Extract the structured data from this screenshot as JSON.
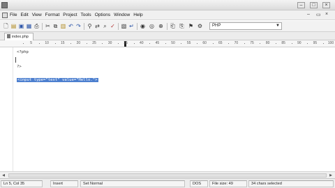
{
  "menubar": {
    "items": [
      "File",
      "Edit",
      "View",
      "Format",
      "Project",
      "Tools",
      "Options",
      "Window",
      "Help"
    ]
  },
  "toolbar": {
    "syntax_selected": "PHP"
  },
  "tabs": [
    {
      "label": "index.php"
    }
  ],
  "ruler": {
    "marks": [
      "5",
      "10",
      "15",
      "20",
      "25",
      "30",
      "35",
      "40",
      "45",
      "50",
      "55",
      "60",
      "65",
      "70",
      "75",
      "80",
      "85",
      "90",
      "95",
      "100"
    ]
  },
  "editor": {
    "lines": [
      "<?php",
      "?>",
      "<input type=\"text\" value=\"Hello.\">"
    ]
  },
  "status": {
    "position": "Ln 5, Col 35",
    "mode": "Insert",
    "style_set": "Set Normal",
    "line_endings": "DOS",
    "file_size": "File size: 49",
    "selection": "34 chars selected"
  },
  "icons": {
    "window_controls": [
      "minimize-icon",
      "maximize-icon",
      "close-icon"
    ],
    "toolbar": [
      "new-file-icon",
      "open-file-icon",
      "save-icon",
      "save-all-icon",
      "print-icon",
      "cut-icon",
      "copy-icon",
      "paste-icon",
      "undo-icon",
      "redo-icon",
      "find-icon",
      "find-replace-icon",
      "find-in-files-icon",
      "spellcheck-icon",
      "clip-icon",
      "browser-preview-icon",
      "server-preview-icon",
      "ftp-icon"
    ]
  },
  "colors": {
    "selection": "#4c7fcf"
  }
}
